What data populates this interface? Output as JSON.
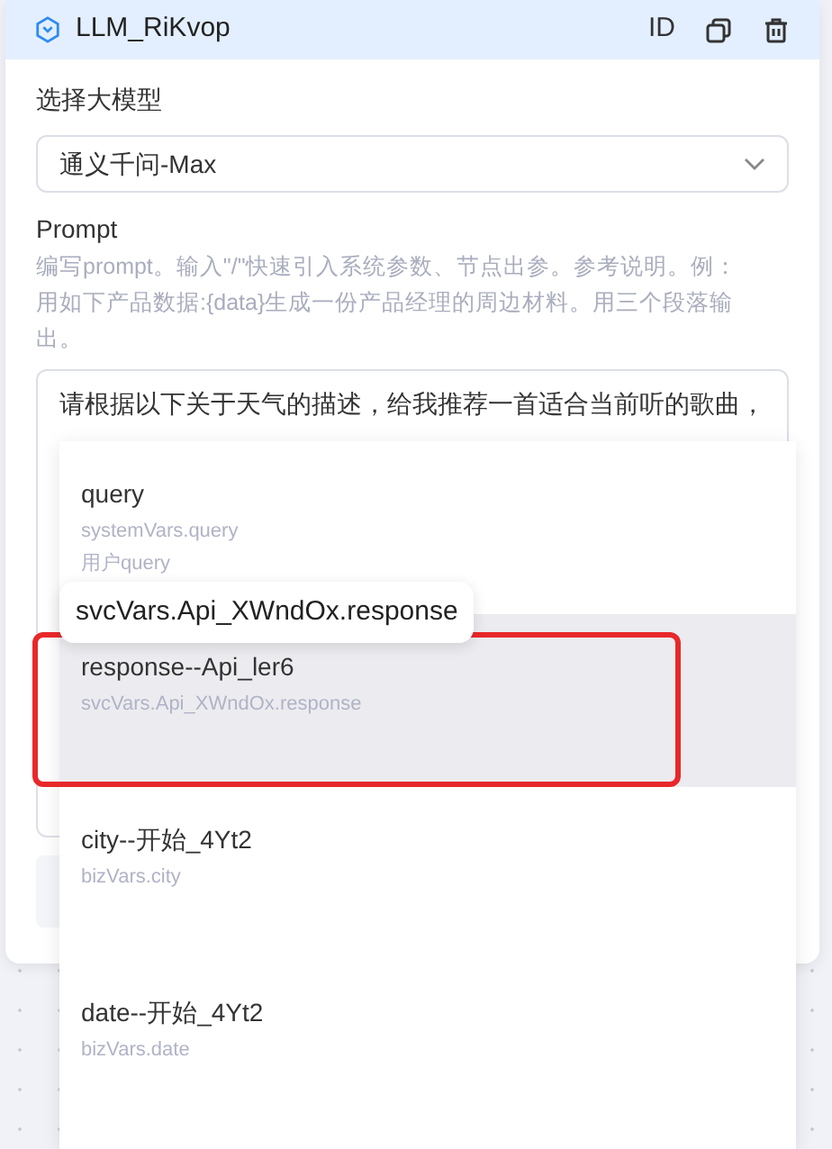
{
  "node": {
    "title": "LLM_RiKvop",
    "actions": [
      {
        "kind": "id",
        "label": "ID"
      },
      {
        "kind": "copy"
      },
      {
        "kind": "delete"
      }
    ]
  },
  "model": {
    "label": "选择大模型",
    "value": "通义千问-Max"
  },
  "prompt": {
    "label": "Prompt",
    "hint": "编写prompt。输入\"/\"快速引入系统参数、节点出参。参考说明。例：用如下产品数据:{data}生成一份产品经理的周边材料。用三个段落输出。",
    "value": "请根据以下关于天气的描述，给我推荐一首适合当前听的歌曲，"
  },
  "suggestions": [
    {
      "name": "query",
      "path": "systemVars.query",
      "description": "用户query",
      "selected": false
    },
    {
      "name": "response--Api_ler6",
      "path": "svcVars.Api_XWndOx.response",
      "selected": true
    },
    {
      "name": "city--开始_4Yt2",
      "path": "bizVars.city",
      "selected": false
    },
    {
      "name": "date--开始_4Yt2",
      "path": "bizVars.date",
      "selected": false
    }
  ],
  "tooltip": "svcVars.Api_XWndOx.response"
}
